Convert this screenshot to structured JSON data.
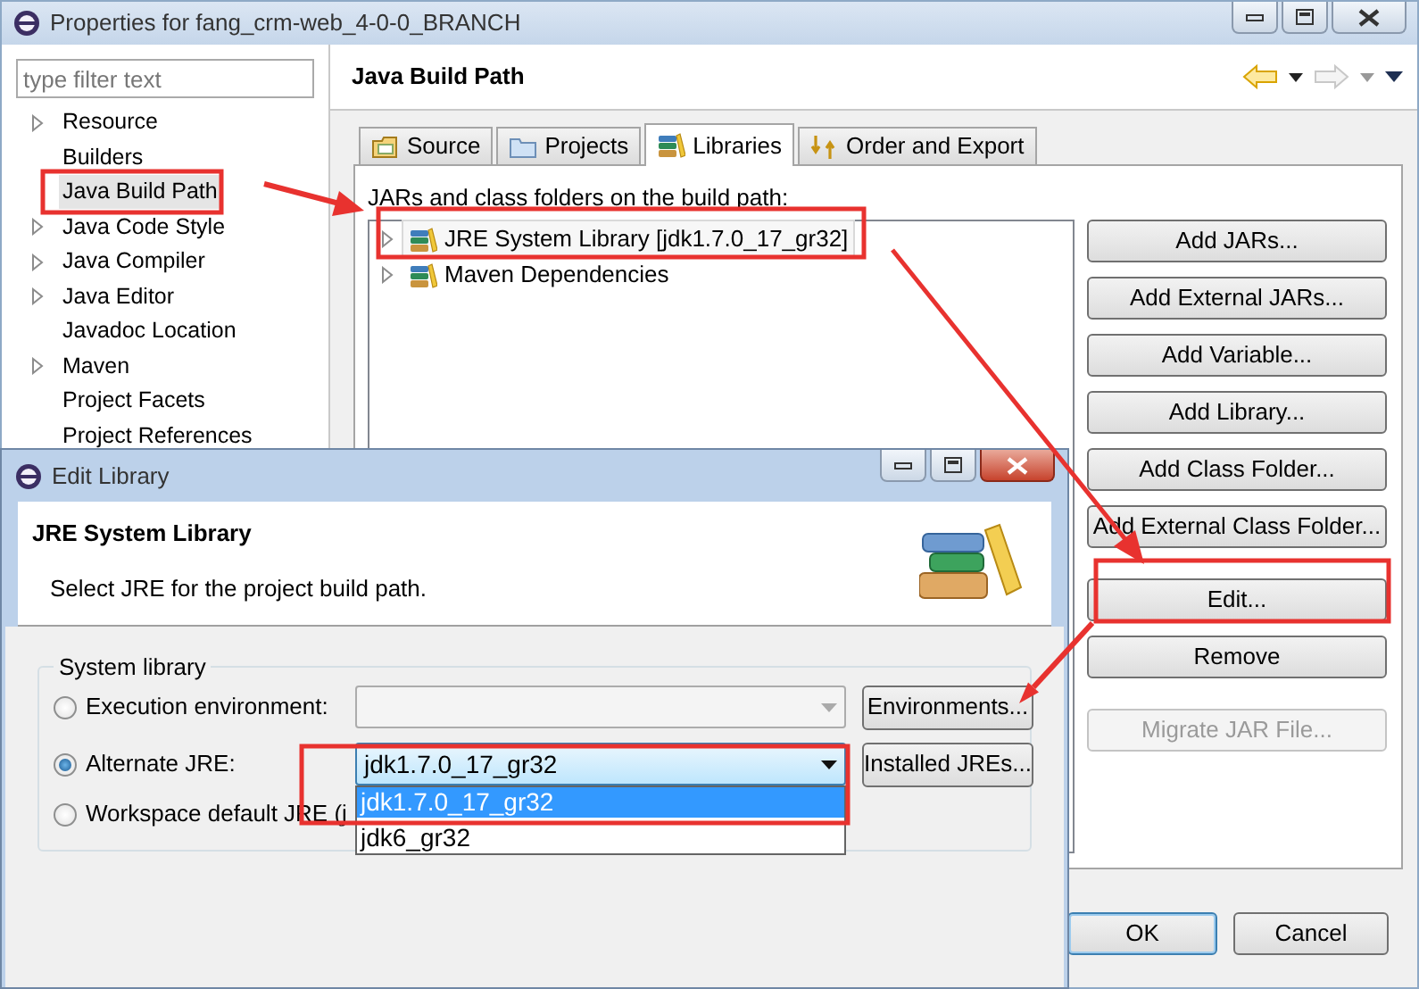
{
  "window": {
    "title": "Properties for fang_crm-web_4-0-0_BRANCH"
  },
  "filter": {
    "placeholder": "type filter text"
  },
  "sidebar": {
    "items": [
      {
        "label": "Resource",
        "expandable": true,
        "selected": false
      },
      {
        "label": "Builders",
        "expandable": false,
        "selected": false
      },
      {
        "label": "Java Build Path",
        "expandable": false,
        "selected": true
      },
      {
        "label": "Java Code Style",
        "expandable": true,
        "selected": false
      },
      {
        "label": "Java Compiler",
        "expandable": true,
        "selected": false
      },
      {
        "label": "Java Editor",
        "expandable": true,
        "selected": false
      },
      {
        "label": "Javadoc Location",
        "expandable": false,
        "selected": false
      },
      {
        "label": "Maven",
        "expandable": true,
        "selected": false
      },
      {
        "label": "Project Facets",
        "expandable": false,
        "selected": false
      },
      {
        "label": "Project References",
        "expandable": false,
        "selected": false
      }
    ]
  },
  "page": {
    "title": "Java Build Path"
  },
  "tabs": [
    {
      "label": "Source",
      "kind": "source",
      "selected": false
    },
    {
      "label": "Projects",
      "kind": "projects",
      "selected": false
    },
    {
      "label": "Libraries",
      "kind": "libraries",
      "selected": true
    },
    {
      "label": "Order and Export",
      "kind": "order",
      "selected": false
    }
  ],
  "build_path": {
    "caption": "JARs and class folders on the build path:",
    "entries": [
      {
        "label": "JRE System Library [jdk1.7.0_17_gr32]",
        "selected": true
      },
      {
        "label": "Maven Dependencies",
        "selected": false
      }
    ]
  },
  "button_groups": [
    [
      {
        "label": "Add JARs...",
        "disabled": false
      },
      {
        "label": "Add External JARs...",
        "disabled": false
      },
      {
        "label": "Add Variable...",
        "disabled": false
      },
      {
        "label": "Add Library...",
        "disabled": false
      },
      {
        "label": "Add Class Folder...",
        "disabled": false
      },
      {
        "label": "Add External Class Folder...",
        "disabled": false
      }
    ],
    [
      {
        "label": "Edit...",
        "disabled": false
      },
      {
        "label": "Remove",
        "disabled": false
      }
    ],
    [
      {
        "label": "Migrate JAR File...",
        "disabled": true
      }
    ]
  ],
  "footer_buttons": [
    {
      "label": "OK",
      "focused": true
    },
    {
      "label": "Cancel",
      "focused": false
    }
  ],
  "dialog": {
    "title": "Edit Library",
    "heading": "JRE System Library",
    "description": "Select JRE for the project build path.",
    "group_title": "System library",
    "options": [
      {
        "kind": "combo",
        "label": "Execution environment:",
        "checked": false,
        "combo": {
          "disabled": true,
          "expanded": false
        },
        "button": "Environments..."
      },
      {
        "kind": "combo",
        "label": "Alternate JRE:",
        "checked": true,
        "combo": {
          "value": "jdk1.7.0_17_gr32",
          "disabled": false,
          "expanded": true,
          "options": [
            {
              "label": "jdk1.7.0_17_gr32",
              "selected": true
            },
            {
              "label": "jdk6_gr32",
              "selected": false
            }
          ]
        },
        "button": "Installed JREs..."
      },
      {
        "kind": "plain",
        "label": "Workspace default JRE (j",
        "checked": false
      }
    ]
  }
}
